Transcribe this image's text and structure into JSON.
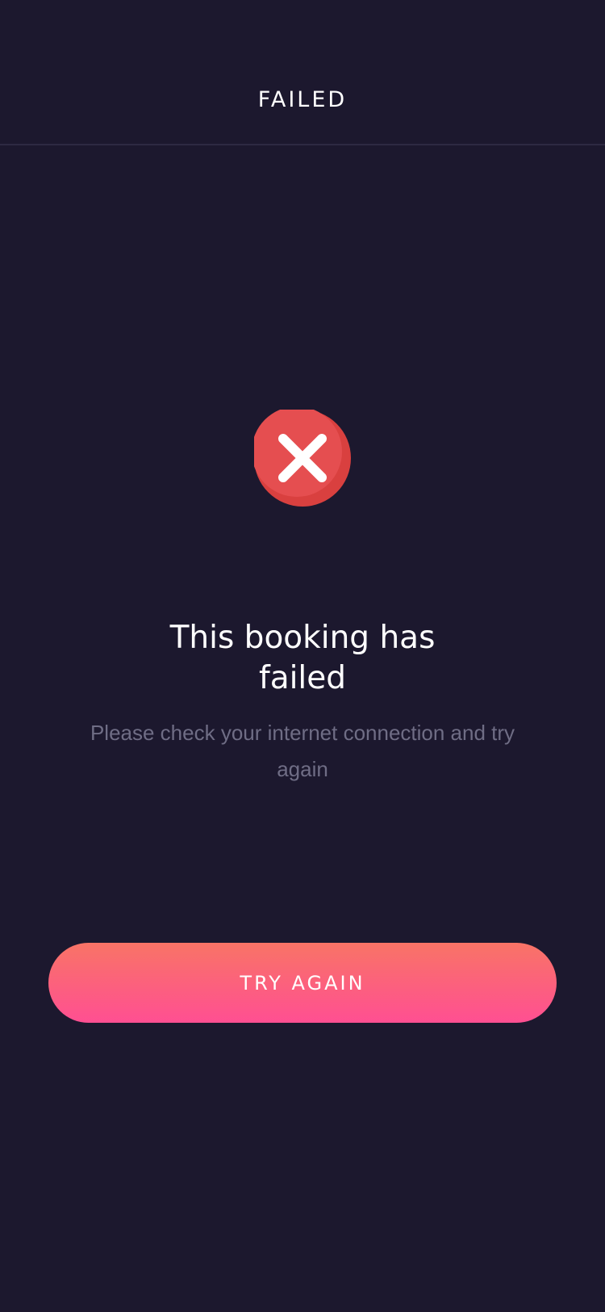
{
  "header": {
    "title": "FAILED"
  },
  "status": {
    "icon": "close-circle-icon",
    "color": "#e54e50"
  },
  "message": {
    "title": "This booking has failed",
    "body": "Please check your internet connection and try again"
  },
  "actions": {
    "try_again_label": "TRY AGAIN",
    "button_gradient": [
      "#f87466",
      "#ff4f92"
    ]
  },
  "theme": {
    "background": "#1c182e",
    "divider": "#2d2942",
    "text_primary": "#ffffff",
    "text_secondary": "#6f6d85"
  }
}
